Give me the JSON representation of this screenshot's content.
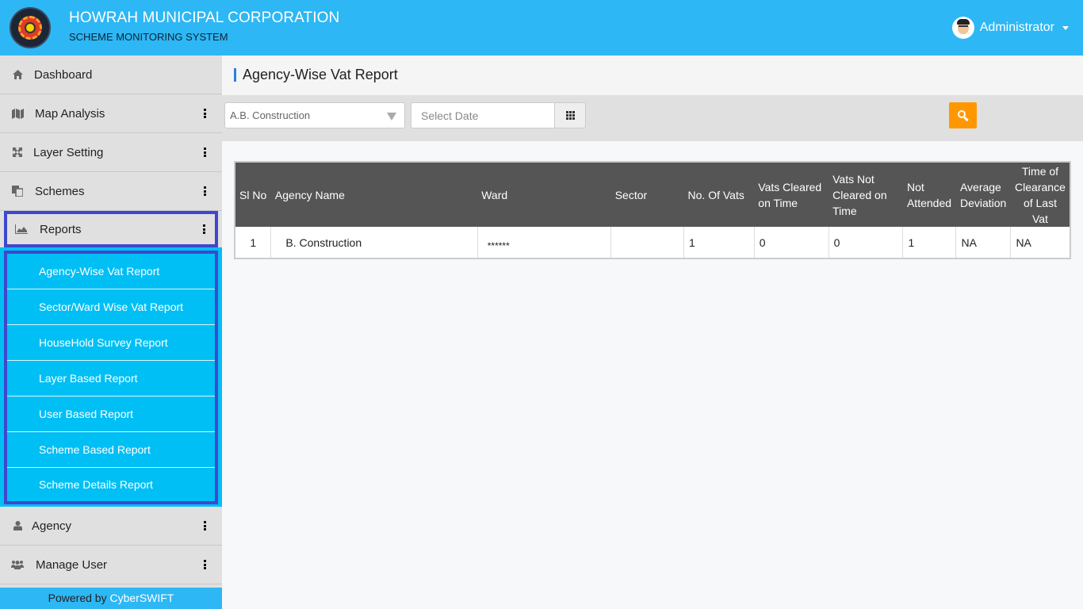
{
  "header": {
    "title": "HOWRAH MUNICIPAL CORPORATION",
    "subtitle": "SCHEME MONITORING SYSTEM",
    "user_name": "Administrator",
    "logo_icon": "municipal-seal-logo",
    "bg_color": "#2db7f5"
  },
  "sidebar": {
    "items": [
      {
        "label": "Dashboard",
        "icon": "home-icon",
        "has_menu": false
      },
      {
        "label": "Map Analysis",
        "icon": "map-icon",
        "has_menu": true
      },
      {
        "label": "Layer Setting",
        "icon": "expand-icon",
        "has_menu": true
      },
      {
        "label": "Schemes",
        "icon": "copy-icon",
        "has_menu": true
      },
      {
        "label": "Reports",
        "icon": "area-chart-icon",
        "has_menu": true,
        "active": true
      },
      {
        "label": "Agency",
        "icon": "user-icon",
        "has_menu": true
      },
      {
        "label": "Manage User",
        "icon": "users-icon",
        "has_menu": true
      }
    ],
    "reports_submenu": [
      "Agency-Wise Vat Report",
      "Sector/Ward Wise Vat Report",
      "HouseHold Survey Report",
      "Layer Based Report",
      "User Based Report",
      "Scheme Based Report",
      "Scheme Details Report"
    ],
    "footer": {
      "prefix": "Powered by ",
      "brand": "CyberSWIFT"
    }
  },
  "main": {
    "page_title": "Agency-Wise Vat Report",
    "filters": {
      "agency_selected": "A.B. Construction",
      "date_placeholder": "Select Date",
      "search_color": "#ff9800"
    },
    "table": {
      "headers": [
        "Sl No",
        "Agency Name",
        "Ward",
        "Sector",
        "No. Of Vats",
        "Vats Cleared on Time",
        "Vats Not Cleared on Time",
        "Not Attended",
        "Average Deviation",
        "Time of Clearance of Last Vat"
      ],
      "rows": [
        {
          "sl_no": "1",
          "agency_name": "B. Construction",
          "ward": "******",
          "sector": "",
          "no_of_vats": "1",
          "vats_cleared_on_time": "0",
          "vats_not_cleared_on_time": "0",
          "not_attended": "1",
          "average_deviation": "NA",
          "time_of_clearance_last_vat": "NA"
        }
      ]
    }
  }
}
